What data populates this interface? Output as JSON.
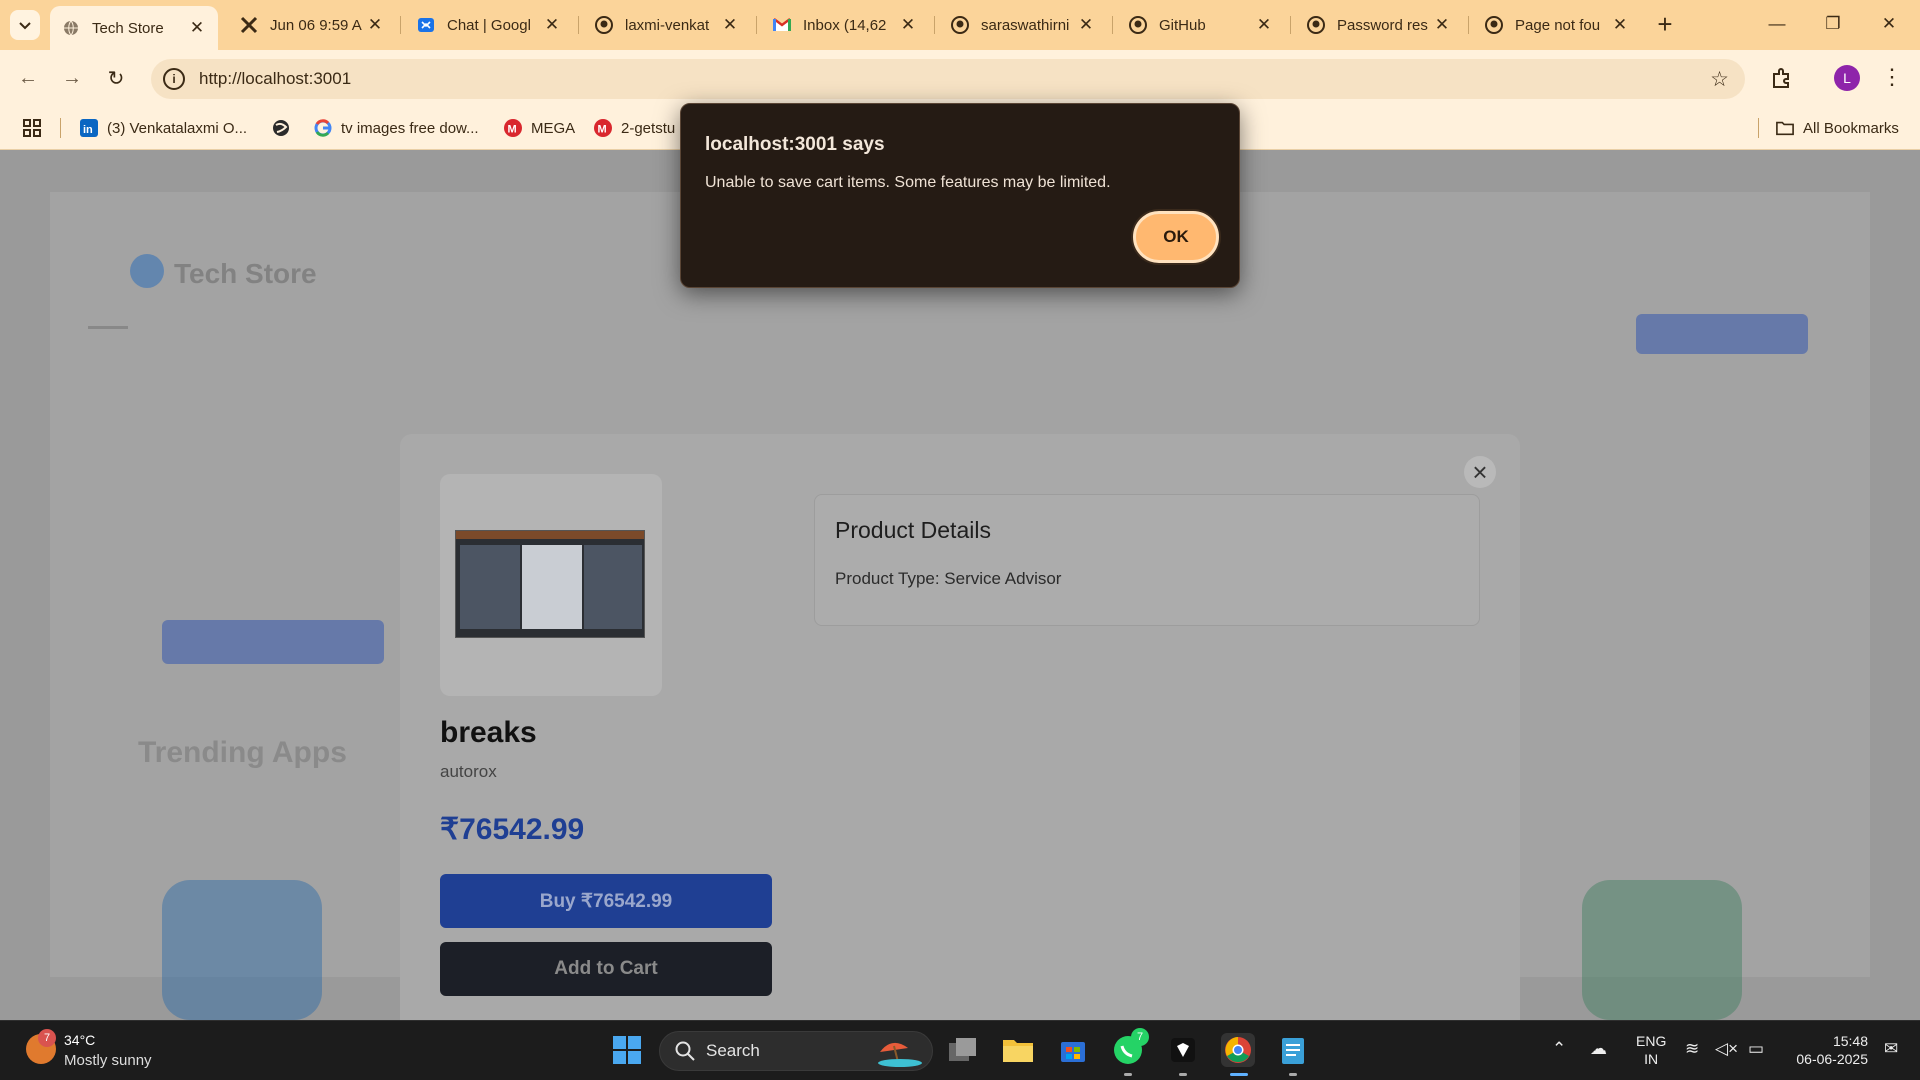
{
  "browser": {
    "tabs": [
      {
        "title": "Tech Store",
        "icon": "globe-icon",
        "active": true
      },
      {
        "title": "Jun 06 9:59 A",
        "icon": "tools-icon",
        "active": false
      },
      {
        "title": "Chat | Googl",
        "icon": "chat-icon",
        "active": false
      },
      {
        "title": "laxmi-venkat",
        "icon": "github-icon",
        "active": false
      },
      {
        "title": "Inbox (14,62",
        "icon": "gmail-icon",
        "active": false
      },
      {
        "title": "saraswathirni",
        "icon": "github-icon",
        "active": false
      },
      {
        "title": "GitHub",
        "icon": "github-icon",
        "active": false
      },
      {
        "title": "Password res",
        "icon": "github-icon",
        "active": false
      },
      {
        "title": "Page not fou",
        "icon": "github-icon",
        "active": false
      }
    ],
    "url": "http://localhost:3001",
    "profile_initial": "L",
    "bookmarks": [
      {
        "label": "(3) Venkatalaxmi O...",
        "icon": "linkedin-icon"
      },
      {
        "label": "",
        "icon": "globe-icon"
      },
      {
        "label": "tv images free dow...",
        "icon": "google-icon"
      },
      {
        "label": "MEGA",
        "icon": "mega-icon"
      },
      {
        "label": "2-getstu",
        "icon": "mega-icon"
      }
    ],
    "all_bookmarks_label": "All Bookmarks"
  },
  "alert": {
    "title": "localhost:3001 says",
    "message": "Unable to save cart items. Some features may be limited.",
    "ok_label": "OK"
  },
  "product": {
    "name": "breaks",
    "brand": "autorox",
    "price": "₹76542.99",
    "buy_label": "Buy ₹76542.99",
    "cart_label": "Add to Cart",
    "details_title": "Product Details",
    "product_type": "Product Type: Service Advisor"
  },
  "background_page": {
    "brand": "Tech Store",
    "section_title": "Trending Apps"
  },
  "taskbar": {
    "weather_badge": "7",
    "temperature": "34°C",
    "weather": "Mostly sunny",
    "search_label": "Search",
    "whatsapp_badge": "7",
    "lang_top": "ENG",
    "lang_bottom": "IN",
    "time": "15:48",
    "date": "06-06-2025"
  },
  "colors": {
    "tabstrip": "#fbd49a",
    "toolbar": "#fff1dc",
    "alert_bg": "#251b14",
    "ok_button": "#ffb870",
    "primary_blue": "#1f3f93"
  }
}
